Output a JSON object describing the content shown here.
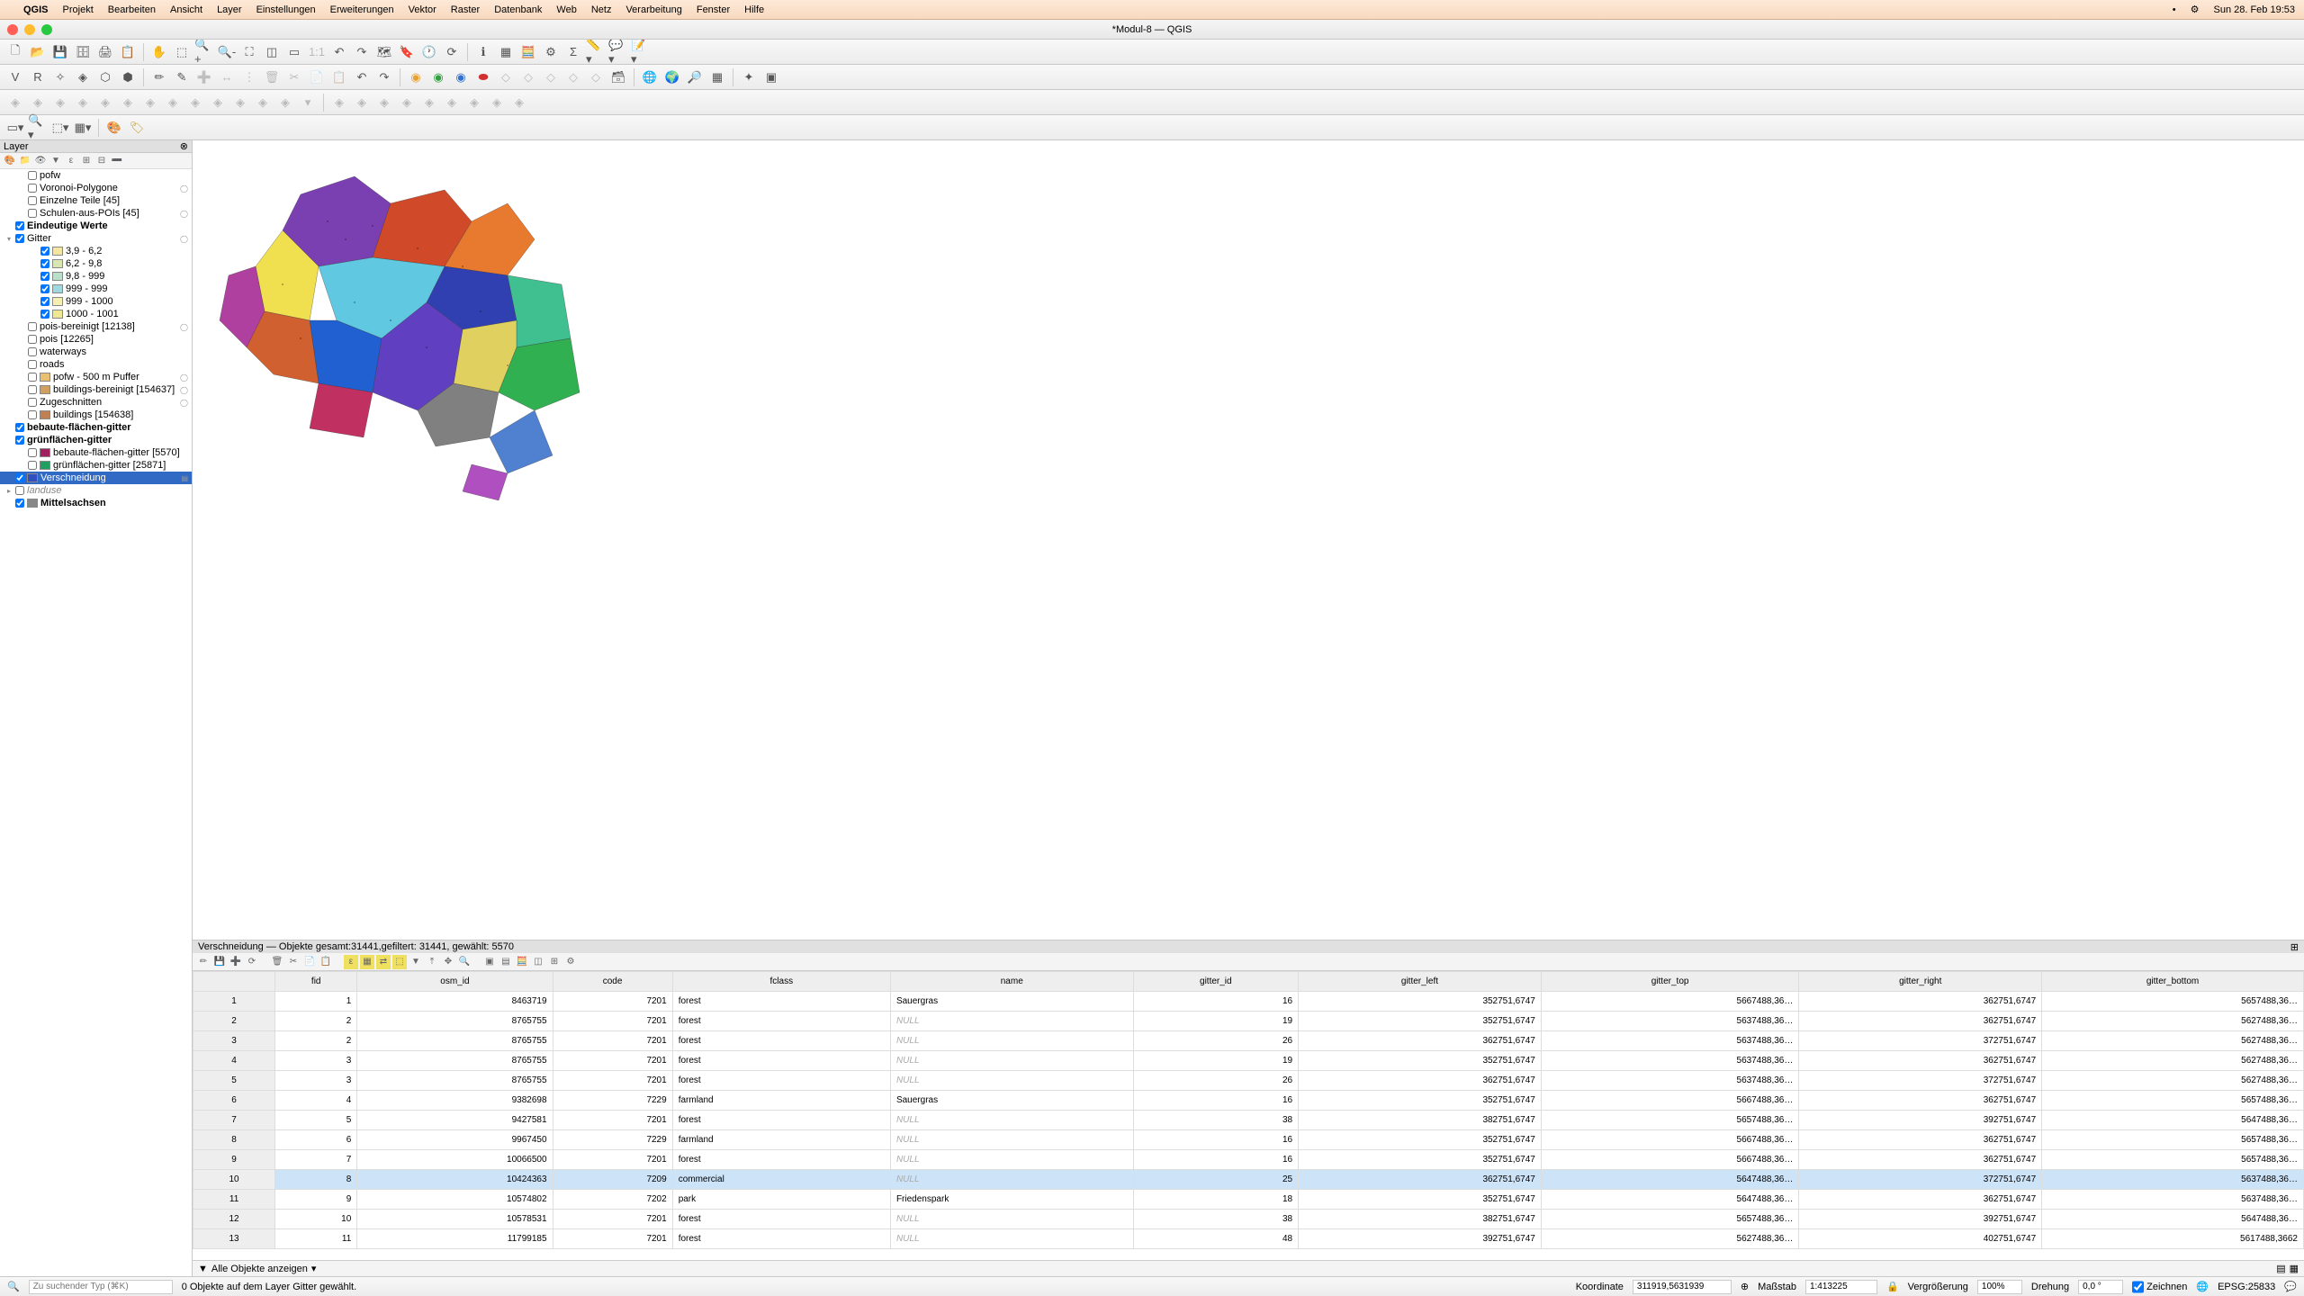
{
  "mac": {
    "app": "QGIS",
    "menus": [
      "Projekt",
      "Bearbeiten",
      "Ansicht",
      "Layer",
      "Einstellungen",
      "Erweiterungen",
      "Vektor",
      "Raster",
      "Datenbank",
      "Web",
      "Netz",
      "Verarbeitung",
      "Fenster",
      "Hilfe"
    ],
    "clock": "Sun 28. Feb  19:53"
  },
  "window_title": "*Modul-8 — QGIS",
  "layers_panel": {
    "title": "Layer",
    "items": [
      {
        "indent": 1,
        "check": false,
        "label": "pofw"
      },
      {
        "indent": 1,
        "check": false,
        "label": "Voronoi-Polygone",
        "count": "◯"
      },
      {
        "indent": 1,
        "check": false,
        "label": "Einzelne Teile [45]"
      },
      {
        "indent": 1,
        "check": false,
        "label": "Schulen-aus-POIs [45]",
        "count": "◯"
      },
      {
        "indent": 0,
        "check": true,
        "bold": true,
        "label": "Eindeutige Werte"
      },
      {
        "indent": 0,
        "check": true,
        "exp": "▾",
        "label": "Gitter",
        "count": "◯"
      },
      {
        "indent": 2,
        "check": true,
        "sw": "#f2e6a0",
        "label": "3,9 - 6,2"
      },
      {
        "indent": 2,
        "check": true,
        "sw": "#d8e8b0",
        "label": "6,2 - 9,8"
      },
      {
        "indent": 2,
        "check": true,
        "sw": "#b8e0c8",
        "label": "9,8 - 999"
      },
      {
        "indent": 2,
        "check": true,
        "sw": "#a0d8e0",
        "label": "999 - 999"
      },
      {
        "indent": 2,
        "check": true,
        "sw": "#f5f0b0",
        "label": "999 - 1000"
      },
      {
        "indent": 2,
        "check": true,
        "sw": "#f0e890",
        "label": "1000 - 1001"
      },
      {
        "indent": 1,
        "check": false,
        "label": "pois-bereinigt [12138]",
        "count": "◯"
      },
      {
        "indent": 1,
        "check": false,
        "label": "pois [12265]"
      },
      {
        "indent": 1,
        "check": false,
        "label": "waterways"
      },
      {
        "indent": 1,
        "check": false,
        "label": "roads"
      },
      {
        "indent": 1,
        "check": false,
        "sw": "#e8c070",
        "label": "pofw - 500 m Puffer",
        "count": "◯"
      },
      {
        "indent": 1,
        "check": false,
        "sw": "#d0a060",
        "label": "buildings-bereinigt [154637]",
        "count": "◯"
      },
      {
        "indent": 1,
        "check": false,
        "label": "Zugeschnitten",
        "count": "◯"
      },
      {
        "indent": 1,
        "check": false,
        "sw": "#c08050",
        "label": "buildings [154638]"
      },
      {
        "indent": 0,
        "check": true,
        "bold": true,
        "label": "bebaute-flächen-gitter"
      },
      {
        "indent": 0,
        "check": true,
        "bold": true,
        "label": "grünflächen-gitter"
      },
      {
        "indent": 1,
        "check": false,
        "sw": "#a02060",
        "label": "bebaute-flächen-gitter [5570]"
      },
      {
        "indent": 1,
        "check": false,
        "sw": "#20a060",
        "label": "grünflächen-gitter [25871]"
      },
      {
        "indent": 0,
        "check": true,
        "sw": "#3050c0",
        "label": "Verschneidung",
        "sel": true,
        "count": "▤"
      },
      {
        "indent": 0,
        "check": false,
        "exp": "▸",
        "label": "landuse",
        "italic": true
      },
      {
        "indent": 0,
        "check": true,
        "sw": "#888",
        "bold": true,
        "label": "Mittelsachsen"
      }
    ]
  },
  "attr": {
    "title": "Verschneidung — Objekte gesamt:31441,gefiltert: 31441, gewählt: 5570",
    "headers": [
      "",
      "fid",
      "osm_id",
      "code",
      "fclass",
      "name",
      "gitter_id",
      "gitter_left",
      "gitter_top",
      "gitter_right",
      "gitter_bottom"
    ],
    "rows": [
      {
        "n": 1,
        "fid": 1,
        "osm": "8463719",
        "code": 7201,
        "fclass": "forest",
        "name": "Sauergras",
        "gid": 16,
        "gl": "352751,6747",
        "gt": "5667488,36…",
        "gr": "362751,6747",
        "gb": "5657488,36…"
      },
      {
        "n": 2,
        "fid": 2,
        "osm": "8765755",
        "code": 7201,
        "fclass": "forest",
        "name": null,
        "gid": 19,
        "gl": "352751,6747",
        "gt": "5637488,36…",
        "gr": "362751,6747",
        "gb": "5627488,36…"
      },
      {
        "n": 3,
        "fid": 2,
        "osm": "8765755",
        "code": 7201,
        "fclass": "forest",
        "name": null,
        "gid": 26,
        "gl": "362751,6747",
        "gt": "5637488,36…",
        "gr": "372751,6747",
        "gb": "5627488,36…"
      },
      {
        "n": 4,
        "fid": 3,
        "osm": "8765755",
        "code": 7201,
        "fclass": "forest",
        "name": null,
        "gid": 19,
        "gl": "352751,6747",
        "gt": "5637488,36…",
        "gr": "362751,6747",
        "gb": "5627488,36…"
      },
      {
        "n": 5,
        "fid": 3,
        "osm": "8765755",
        "code": 7201,
        "fclass": "forest",
        "name": null,
        "gid": 26,
        "gl": "362751,6747",
        "gt": "5637488,36…",
        "gr": "372751,6747",
        "gb": "5627488,36…"
      },
      {
        "n": 6,
        "fid": 4,
        "osm": "9382698",
        "code": 7229,
        "fclass": "farmland",
        "name": "Sauergras",
        "gid": 16,
        "gl": "352751,6747",
        "gt": "5667488,36…",
        "gr": "362751,6747",
        "gb": "5657488,36…"
      },
      {
        "n": 7,
        "fid": 5,
        "osm": "9427581",
        "code": 7201,
        "fclass": "forest",
        "name": null,
        "gid": 38,
        "gl": "382751,6747",
        "gt": "5657488,36…",
        "gr": "392751,6747",
        "gb": "5647488,36…"
      },
      {
        "n": 8,
        "fid": 6,
        "osm": "9967450",
        "code": 7229,
        "fclass": "farmland",
        "name": null,
        "gid": 16,
        "gl": "352751,6747",
        "gt": "5667488,36…",
        "gr": "362751,6747",
        "gb": "5657488,36…"
      },
      {
        "n": 9,
        "fid": 7,
        "osm": "10066500",
        "code": 7201,
        "fclass": "forest",
        "name": null,
        "gid": 16,
        "gl": "352751,6747",
        "gt": "5667488,36…",
        "gr": "362751,6747",
        "gb": "5657488,36…"
      },
      {
        "n": 10,
        "fid": 8,
        "osm": "10424363",
        "code": 7209,
        "fclass": "commercial",
        "name": null,
        "gid": 25,
        "gl": "362751,6747",
        "gt": "5647488,36…",
        "gr": "372751,6747",
        "gb": "5637488,36…",
        "sel": true
      },
      {
        "n": 11,
        "fid": 9,
        "osm": "10574802",
        "code": 7202,
        "fclass": "park",
        "name": "Friedenspark",
        "gid": 18,
        "gl": "352751,6747",
        "gt": "5647488,36…",
        "gr": "362751,6747",
        "gb": "5637488,36…"
      },
      {
        "n": 12,
        "fid": 10,
        "osm": "10578531",
        "code": 7201,
        "fclass": "forest",
        "name": null,
        "gid": 38,
        "gl": "382751,6747",
        "gt": "5657488,36…",
        "gr": "392751,6747",
        "gb": "5647488,36…"
      },
      {
        "n": 13,
        "fid": 11,
        "osm": "11799185",
        "code": 7201,
        "fclass": "forest",
        "name": null,
        "gid": 48,
        "gl": "392751,6747",
        "gt": "5627488,36…",
        "gr": "402751,6747",
        "gb": "5617488,3662"
      }
    ],
    "footer_filter": "Alle Objekte anzeigen"
  },
  "status": {
    "search_ph": "Zu suchender Typ (⌘K)",
    "msg": "0 Objekte auf dem Layer Gitter gewählt.",
    "coord_lbl": "Koordinate",
    "coord": "311919,5631939",
    "scale_lbl": "Maßstab",
    "scale": "1:413225",
    "mag_lbl": "Vergrößerung",
    "mag": "100%",
    "rot_lbl": "Drehung",
    "rot": "0,0 °",
    "render": "Zeichnen",
    "crs": "EPSG:25833"
  }
}
